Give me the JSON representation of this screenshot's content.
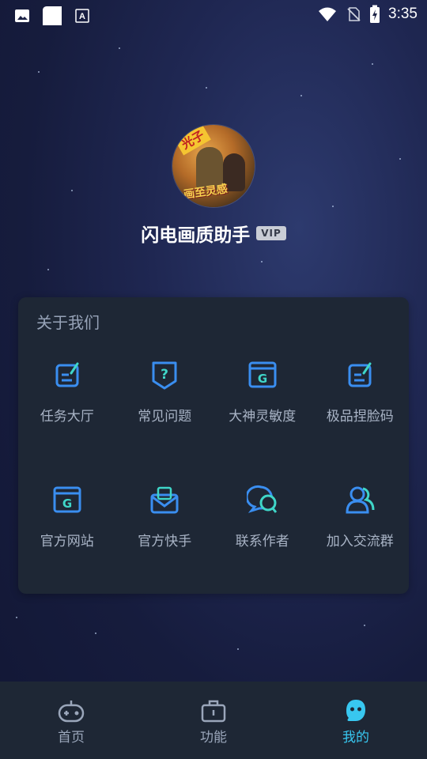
{
  "status_bar": {
    "time": "3:35",
    "icons": [
      "image-icon",
      "square-app-icon",
      "a-box-icon",
      "wifi-icon",
      "no-sim-icon",
      "battery-charging-icon"
    ]
  },
  "profile": {
    "app_name": "闪电画质助手",
    "badge": "VIP",
    "avatar_text_1": "光子",
    "avatar_text_2": "画至灵感"
  },
  "about": {
    "title": "关于我们",
    "items": [
      {
        "label": "任务大厅",
        "icon": "edit-note-icon"
      },
      {
        "label": "常见问题",
        "icon": "question-shield-icon"
      },
      {
        "label": "大神灵敏度",
        "icon": "g-window-icon"
      },
      {
        "label": "极品捏脸码",
        "icon": "edit-note-icon"
      },
      {
        "label": "官方网站",
        "icon": "g-window-icon"
      },
      {
        "label": "官方快手",
        "icon": "mail-tray-icon"
      },
      {
        "label": "联系作者",
        "icon": "chat-bubbles-icon"
      },
      {
        "label": "加入交流群",
        "icon": "group-users-icon"
      }
    ]
  },
  "tabbar": {
    "tabs": [
      {
        "label": "首页",
        "icon": "gamepad-icon",
        "active": false
      },
      {
        "label": "功能",
        "icon": "toolbox-icon",
        "active": false
      },
      {
        "label": "我的",
        "icon": "mascot-icon",
        "active": true
      }
    ]
  },
  "colors": {
    "accent": "#38c7f0",
    "icon_blue": "#3a8ef0",
    "icon_teal": "#3fd6c8",
    "card_bg": "#1e2735"
  }
}
